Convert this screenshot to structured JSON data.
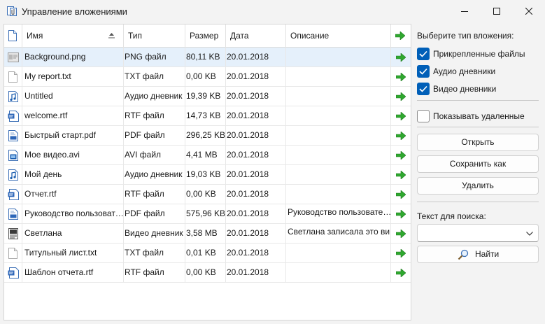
{
  "window": {
    "title": "Управление вложениями"
  },
  "table": {
    "columns": {
      "name": "Имя",
      "type": "Тип",
      "size": "Размер",
      "date": "Дата",
      "description": "Описание"
    },
    "rows": [
      {
        "icon": "image-file-icon",
        "name": "Background.png",
        "type": "PNG файл",
        "size": "80,11 KB",
        "date": "20.01.2018",
        "description": "",
        "selected": true
      },
      {
        "icon": "blank-file-icon",
        "name": "My report.txt",
        "type": "TXT файл",
        "size": "0,00 KB",
        "date": "20.01.2018",
        "description": ""
      },
      {
        "icon": "audio-file-icon",
        "name": "Untitled",
        "type": "Аудио дневник",
        "size": "19,39 KB",
        "date": "20.01.2018",
        "description": ""
      },
      {
        "icon": "rtf-file-icon",
        "name": "welcome.rtf",
        "type": "RTF файл",
        "size": "14,73 KB",
        "date": "20.01.2018",
        "description": ""
      },
      {
        "icon": "pdf-file-icon",
        "name": "Быстрый старт.pdf",
        "type": "PDF файл",
        "size": "296,25 KB",
        "date": "20.01.2018",
        "description": ""
      },
      {
        "icon": "video-file-icon",
        "name": "Мое видео.avi",
        "type": "AVI файл",
        "size": "4,41 MB",
        "date": "20.01.2018",
        "description": ""
      },
      {
        "icon": "audio-file-icon",
        "name": "Мой день",
        "type": "Аудио дневник",
        "size": "19,03 KB",
        "date": "20.01.2018",
        "description": ""
      },
      {
        "icon": "rtf-file-icon",
        "name": "Отчет.rtf",
        "type": "RTF файл",
        "size": "0,00 KB",
        "date": "20.01.2018",
        "description": ""
      },
      {
        "icon": "pdf-file-icon",
        "name": "Руководство пользоват…",
        "type": "PDF файл",
        "size": "575,96 KB",
        "date": "20.01.2018",
        "description": "Руководство пользовате…"
      },
      {
        "icon": "video-diary-icon",
        "name": "Светлана",
        "type": "Видео дневник",
        "size": "3,58 MB",
        "date": "20.01.2018",
        "description": "Светлана записала это ви…"
      },
      {
        "icon": "blank-file-icon",
        "name": "Титульный лист.txt",
        "type": "TXT файл",
        "size": "0,01 KB",
        "date": "20.01.2018",
        "description": ""
      },
      {
        "icon": "rtf-file-icon",
        "name": "Шаблон отчета.rtf",
        "type": "RTF файл",
        "size": "0,00 KB",
        "date": "20.01.2018",
        "description": ""
      }
    ]
  },
  "panel": {
    "attachment_type_label": "Выберите тип вложения:",
    "checkboxes": [
      {
        "label": "Прикрепленные файлы",
        "checked": true
      },
      {
        "label": "Аудио дневники",
        "checked": true
      },
      {
        "label": "Видео дневники",
        "checked": true
      }
    ],
    "show_deleted": {
      "label": "Показывать удаленные",
      "checked": false
    },
    "buttons": {
      "open": "Открыть",
      "save_as": "Сохранить как",
      "delete": "Удалить"
    },
    "search": {
      "label": "Текст для поиска:",
      "value": "",
      "find_button": "Найти"
    }
  },
  "colors": {
    "accent": "#005fb8",
    "selected_row": "#e5f0fb",
    "arrow_green": "#2fa82f"
  }
}
